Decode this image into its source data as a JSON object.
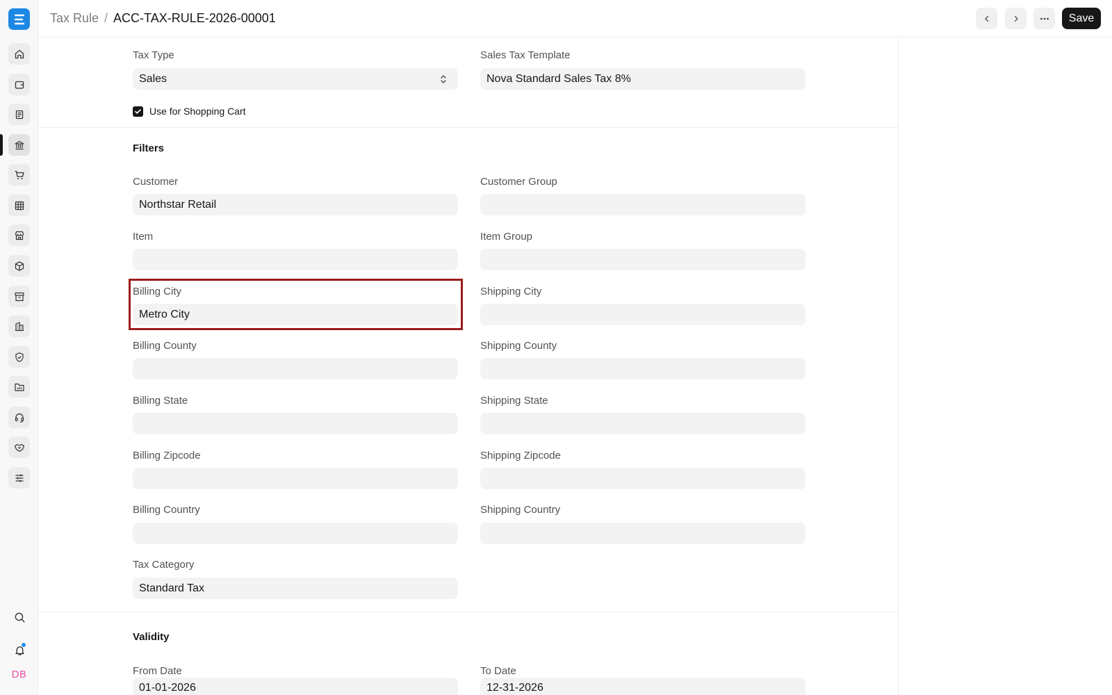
{
  "breadcrumb": {
    "parent": "Tax Rule",
    "separator": "/",
    "current": "ACC-TAX-RULE-2026-00001"
  },
  "toolbar": {
    "save_label": "Save"
  },
  "sidebar": {
    "avatar_initials": "DB",
    "icons": [
      "home-icon",
      "wallet-icon",
      "document-icon",
      "bank-icon",
      "cart-icon",
      "table-icon",
      "store-icon",
      "package-icon",
      "archive-icon",
      "building-icon",
      "shield-icon",
      "folder-chart-icon",
      "headset-icon",
      "handshake-icon",
      "sliders-icon"
    ]
  },
  "form": {
    "tax_type": {
      "label": "Tax Type",
      "value": "Sales"
    },
    "sales_tax_template": {
      "label": "Sales Tax Template",
      "value": "Nova Standard Sales Tax 8%"
    },
    "use_for_shopping_cart": {
      "label": "Use for Shopping Cart",
      "checked": true
    },
    "filters": {
      "title": "Filters",
      "customer": {
        "label": "Customer",
        "value": "Northstar Retail"
      },
      "customer_group": {
        "label": "Customer Group",
        "value": ""
      },
      "item": {
        "label": "Item",
        "value": ""
      },
      "item_group": {
        "label": "Item Group",
        "value": ""
      },
      "billing_city": {
        "label": "Billing City",
        "value": "Metro City"
      },
      "shipping_city": {
        "label": "Shipping City",
        "value": ""
      },
      "billing_county": {
        "label": "Billing County",
        "value": ""
      },
      "shipping_county": {
        "label": "Shipping County",
        "value": ""
      },
      "billing_state": {
        "label": "Billing State",
        "value": ""
      },
      "shipping_state": {
        "label": "Shipping State",
        "value": ""
      },
      "billing_zipcode": {
        "label": "Billing Zipcode",
        "value": ""
      },
      "shipping_zipcode": {
        "label": "Shipping Zipcode",
        "value": ""
      },
      "billing_country": {
        "label": "Billing Country",
        "value": ""
      },
      "shipping_country": {
        "label": "Shipping Country",
        "value": ""
      },
      "tax_category": {
        "label": "Tax Category",
        "value": "Standard Tax"
      }
    },
    "validity": {
      "title": "Validity",
      "from_date": {
        "label": "From Date",
        "value": "01-01-2026"
      },
      "to_date": {
        "label": "To Date",
        "value": "12-31-2026"
      }
    }
  },
  "colors": {
    "brand": "#1e88e5",
    "highlight_border": "#9b1c1c",
    "avatar_text": "#e84fa5",
    "notification_dot": "#2490ef"
  }
}
